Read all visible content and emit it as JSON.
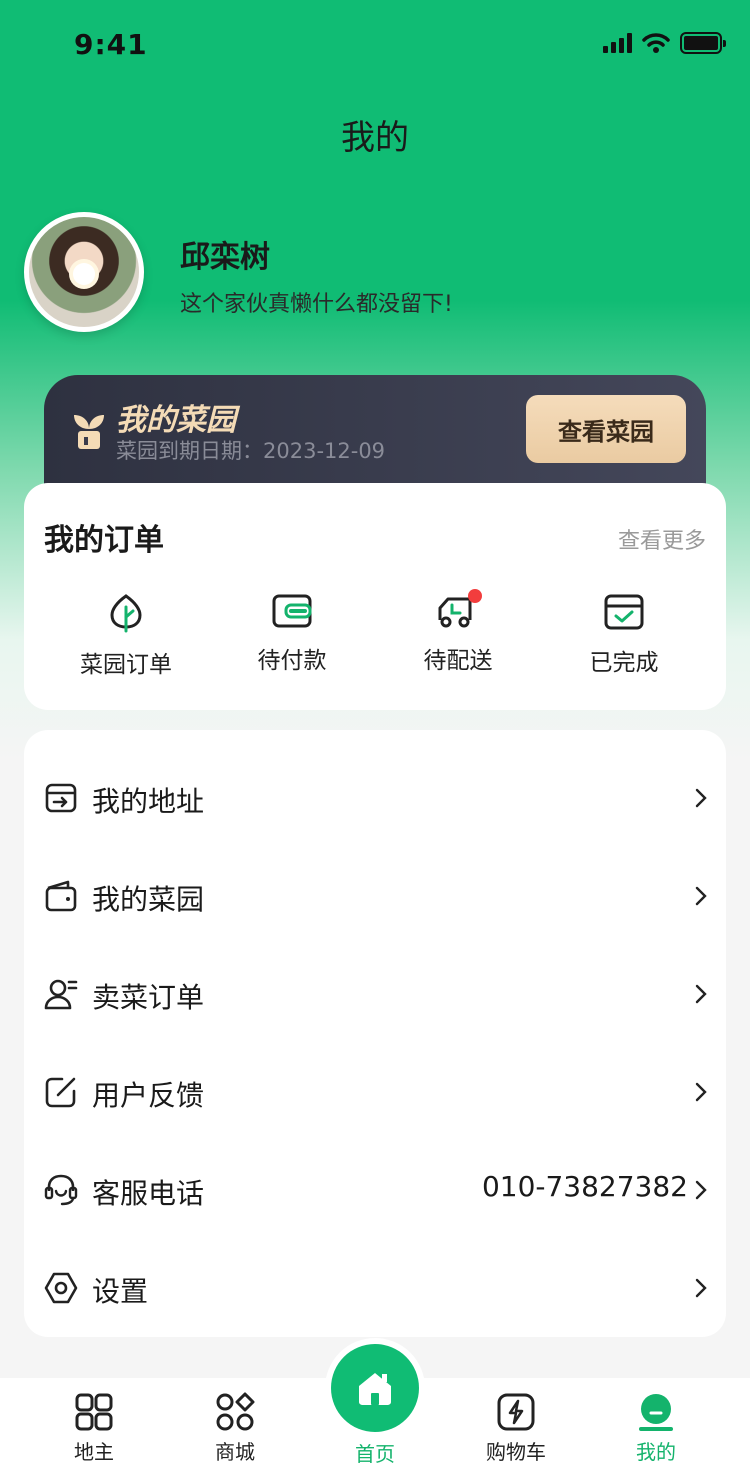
{
  "status_bar": {
    "time": "9:41"
  },
  "header": {
    "title": "我的"
  },
  "profile": {
    "name": "邱栾树",
    "bio": "这个家伙真懒什么都没留下!"
  },
  "garden_banner": {
    "title": "我的菜园",
    "expiry": "菜园到期日期：2023-12-09",
    "button": "查看菜园"
  },
  "orders": {
    "title": "我的订单",
    "more": "查看更多",
    "items": [
      {
        "label": "菜园订单",
        "icon": "leaf-icon"
      },
      {
        "label": "待付款",
        "icon": "wallet-icon"
      },
      {
        "label": "待配送",
        "icon": "truck-icon",
        "badge": true
      },
      {
        "label": "已完成",
        "icon": "box-check-icon"
      }
    ]
  },
  "menu": [
    {
      "label": "我的地址",
      "icon": "address-icon"
    },
    {
      "label": "我的菜园",
      "icon": "wallet-icon"
    },
    {
      "label": "卖菜订单",
      "icon": "user-icon"
    },
    {
      "label": "用户反馈",
      "icon": "edit-icon"
    },
    {
      "label": "客服电话",
      "icon": "headset-icon",
      "value": "010-73827382"
    },
    {
      "label": "设置",
      "icon": "settings-icon"
    }
  ],
  "tabbar": [
    {
      "label": "地主",
      "icon": "grid-icon"
    },
    {
      "label": "商城",
      "icon": "apps-icon"
    },
    {
      "label": "首页",
      "icon": "home-icon"
    },
    {
      "label": "购物车",
      "icon": "flash-icon"
    },
    {
      "label": "我的",
      "icon": "profile-icon",
      "active": true
    }
  ],
  "colors": {
    "brand": "#10bc74",
    "banner": "#3a3c4c",
    "badge": "#f23d3d"
  }
}
